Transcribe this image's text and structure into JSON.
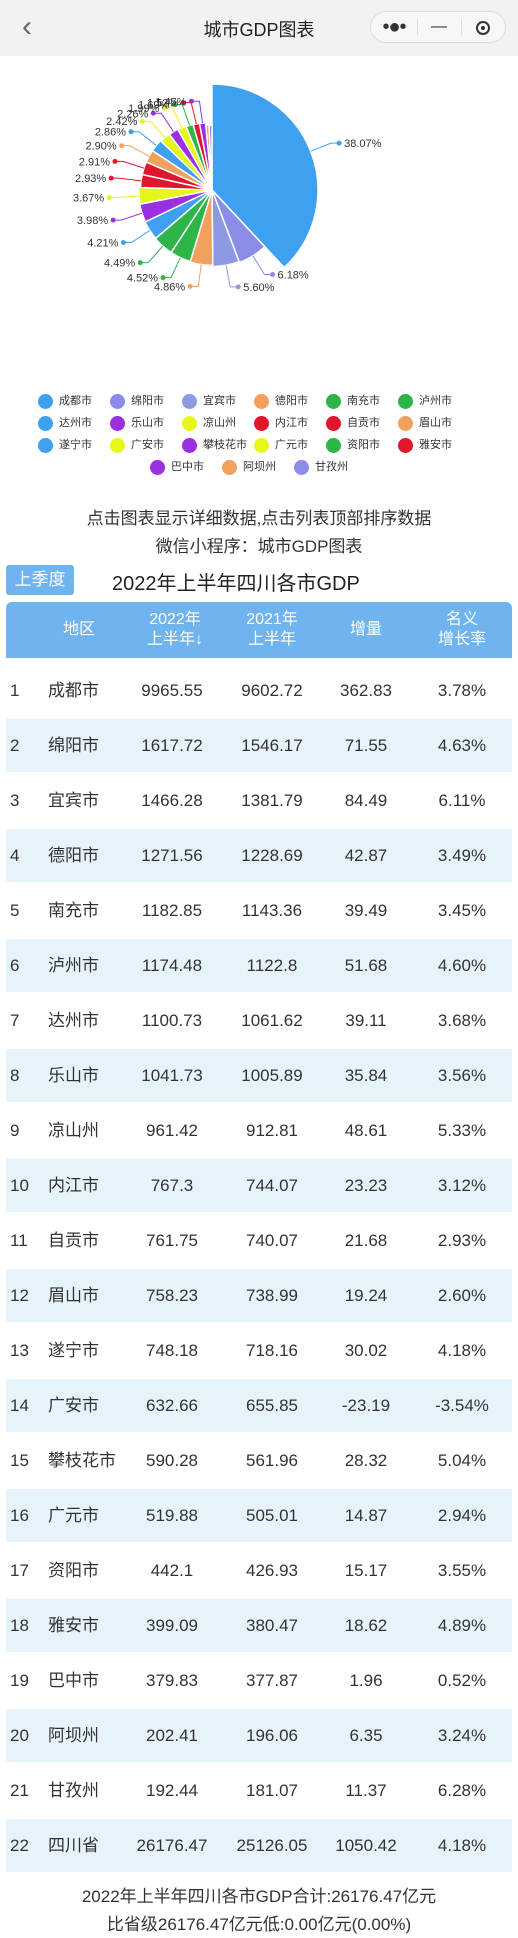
{
  "app": {
    "title": "城市GDP图表",
    "back_icon": "chevron-left-icon",
    "more_icon": "more-dots-icon",
    "minimize_icon": "minimize-icon",
    "close_icon": "target-close-icon"
  },
  "chart_data": {
    "type": "pie",
    "labels": [
      "成都市",
      "绵阳市",
      "宜宾市",
      "德阳市",
      "南充市",
      "泸州市",
      "达州市",
      "乐山市",
      "凉山州",
      "内江市",
      "自贡市",
      "眉山市",
      "遂宁市",
      "广安市",
      "攀枝花市",
      "广元市",
      "资阳市",
      "雅安市",
      "巴中市",
      "阿坝州",
      "甘孜州"
    ],
    "values": [
      38.07,
      6.18,
      5.6,
      4.86,
      4.52,
      4.49,
      4.21,
      3.98,
      3.67,
      2.93,
      2.91,
      2.9,
      2.86,
      2.42,
      2.26,
      1.99,
      1.69,
      1.52,
      1.45,
      0.77,
      0.74
    ],
    "value_labels": [
      "38.07%",
      "6.18%",
      "5.60%",
      "4.86%",
      "4.52%",
      "4.49%",
      "4.21%",
      "3.98%",
      "3.67%",
      "2.93%",
      "2.91%",
      "2.90%",
      "2.86%",
      "2.42%",
      "2.26%",
      "1.99%",
      "1.69%",
      "1.52%",
      "1.45%",
      "",
      ""
    ],
    "colors": [
      "#3ea0f0",
      "#8a8ce8",
      "#8c9ae3",
      "#f2a05e",
      "#2db548",
      "#2db548",
      "#3ea0f0",
      "#9b30e0",
      "#e8f51a",
      "#e0162c",
      "#e0162c",
      "#f2a05e",
      "#3ea0f0",
      "#e8f51a",
      "#9b30e0",
      "#e8f51a",
      "#2db548",
      "#e0162c",
      "#9b30e0",
      "#f2a05e",
      "#8a8ce8"
    ],
    "legend_position": "bottom"
  },
  "hints": {
    "line1": "点击图表显示详细数据,点击列表顶部排序数据",
    "line2": "微信小程序：城市GDP图表"
  },
  "table": {
    "season_button": "上季度",
    "title": "2022年上半年四川各市GDP",
    "headers": {
      "region": "地区",
      "y2022_line1": "2022年",
      "y2022_line2": "上半年",
      "sort_arrow": "↓",
      "y2021_line1": "2021年",
      "y2021_line2": "上半年",
      "increase": "增量",
      "rank_line1": "名义",
      "rank_line2": "增长率"
    },
    "rows": [
      [
        "1",
        "成都市",
        "9965.55",
        "9602.72",
        "362.83",
        "3.78%"
      ],
      [
        "2",
        "绵阳市",
        "1617.72",
        "1546.17",
        "71.55",
        "4.63%"
      ],
      [
        "3",
        "宜宾市",
        "1466.28",
        "1381.79",
        "84.49",
        "6.11%"
      ],
      [
        "4",
        "德阳市",
        "1271.56",
        "1228.69",
        "42.87",
        "3.49%"
      ],
      [
        "5",
        "南充市",
        "1182.85",
        "1143.36",
        "39.49",
        "3.45%"
      ],
      [
        "6",
        "泸州市",
        "1174.48",
        "1122.8",
        "51.68",
        "4.60%"
      ],
      [
        "7",
        "达州市",
        "1100.73",
        "1061.62",
        "39.11",
        "3.68%"
      ],
      [
        "8",
        "乐山市",
        "1041.73",
        "1005.89",
        "35.84",
        "3.56%"
      ],
      [
        "9",
        "凉山州",
        "961.42",
        "912.81",
        "48.61",
        "5.33%"
      ],
      [
        "10",
        "内江市",
        "767.3",
        "744.07",
        "23.23",
        "3.12%"
      ],
      [
        "11",
        "自贡市",
        "761.75",
        "740.07",
        "21.68",
        "2.93%"
      ],
      [
        "12",
        "眉山市",
        "758.23",
        "738.99",
        "19.24",
        "2.60%"
      ],
      [
        "13",
        "遂宁市",
        "748.18",
        "718.16",
        "30.02",
        "4.18%"
      ],
      [
        "14",
        "广安市",
        "632.66",
        "655.85",
        "-23.19",
        "-3.54%"
      ],
      [
        "15",
        "攀枝花市",
        "590.28",
        "561.96",
        "28.32",
        "5.04%"
      ],
      [
        "16",
        "广元市",
        "519.88",
        "505.01",
        "14.87",
        "2.94%"
      ],
      [
        "17",
        "资阳市",
        "442.1",
        "426.93",
        "15.17",
        "3.55%"
      ],
      [
        "18",
        "雅安市",
        "399.09",
        "380.47",
        "18.62",
        "4.89%"
      ],
      [
        "19",
        "巴中市",
        "379.83",
        "377.87",
        "1.96",
        "0.52%"
      ],
      [
        "20",
        "阿坝州",
        "202.41",
        "196.06",
        "6.35",
        "3.24%"
      ],
      [
        "21",
        "甘孜州",
        "192.44",
        "181.07",
        "11.37",
        "6.28%"
      ],
      [
        "22",
        "四川省",
        "26176.47",
        "25126.05",
        "1050.42",
        "4.18%"
      ]
    ]
  },
  "summary": {
    "line1": "2022年上半年四川各市GDP合计:26176.47亿元",
    "line2": "比省级26176.47亿元低:0.00亿元(0.00%)"
  }
}
